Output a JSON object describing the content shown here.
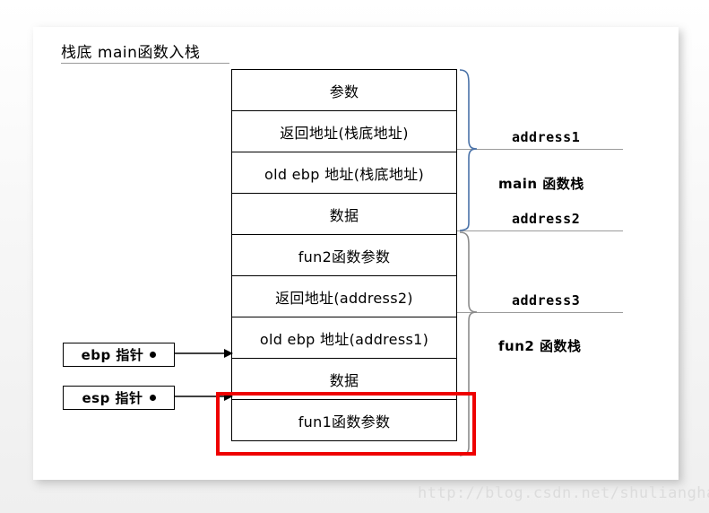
{
  "title": "栈底 main函数入栈",
  "stack_rows": [
    {
      "label": "参数"
    },
    {
      "label": "返回地址(栈底地址)"
    },
    {
      "label": "old ebp 地址(栈底地址)"
    },
    {
      "label": "数据"
    },
    {
      "label": "fun2函数参数"
    },
    {
      "label": "返回地址(address2)"
    },
    {
      "label": "old ebp 地址(address1)"
    },
    {
      "label": "数据"
    },
    {
      "label": "fun1函数参数"
    }
  ],
  "annotations": {
    "address1": "address1",
    "address2": "address2",
    "address3": "address3",
    "main_stack": "main 函数栈",
    "fun2_stack": "fun2 函数栈"
  },
  "pointers": {
    "ebp": "ebp 指针",
    "esp": "esp 指针"
  },
  "colors": {
    "highlight": "#ee0000",
    "brace_main": "#4a72a8",
    "brace_fun2": "#8c8c8c",
    "guide_line": "#9b9b9b"
  },
  "watermark": "http://blog.csdn.net/shulianghan"
}
